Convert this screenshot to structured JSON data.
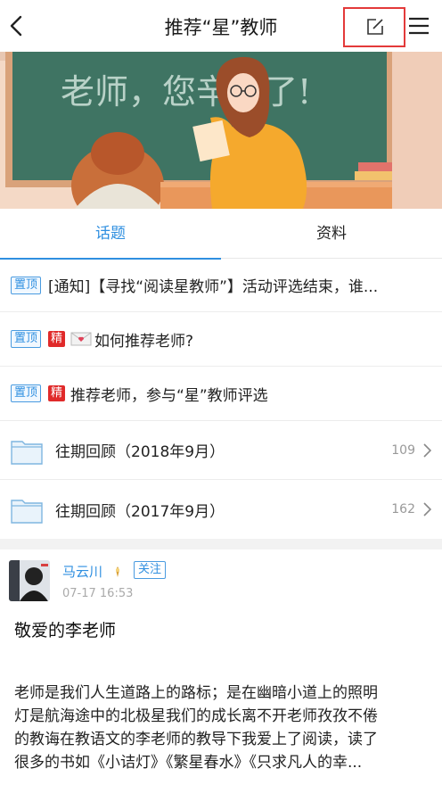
{
  "header": {
    "title": "推荐“星”教师"
  },
  "banner": {
    "board_text": "老师，您辛苦了!"
  },
  "tabs": [
    {
      "label": "话题"
    },
    {
      "label": "资料"
    }
  ],
  "topics": [
    {
      "badge_top": "置顶",
      "text": "[通知]【寻找“阅读星教师”】活动评选结束，谁..."
    },
    {
      "badge_top": "置顶",
      "badge_jing": "精",
      "text": "如何推荐老师?"
    },
    {
      "badge_top": "置顶",
      "badge_jing": "精",
      "text": "推荐老师，参与“星”教师评选"
    }
  ],
  "folders": [
    {
      "text": "往期回顾（2018年9月）",
      "count": "109"
    },
    {
      "text": "往期回顾（2017年9月）",
      "count": "162"
    }
  ],
  "post": {
    "author": "马云川",
    "follow_label": "关注",
    "time": "07-17 16:53",
    "title": "敬爱的李老师",
    "body_lines": [
      "老师是我们人生道路上的路标；是在幽暗小道上的照明",
      "灯是航海途中的北极星我们的成长离不开老师孜孜不倦",
      "的教诲在教语文的李老师的教导下我爱上了阅读，读了",
      "很多的书如《小诘灯》《繁星春水》《只求凡人的幸..."
    ]
  },
  "colors": {
    "accent": "#2f8fe0",
    "highlight_box": "#e33a3a",
    "jing_badge": "#e02a2a"
  }
}
